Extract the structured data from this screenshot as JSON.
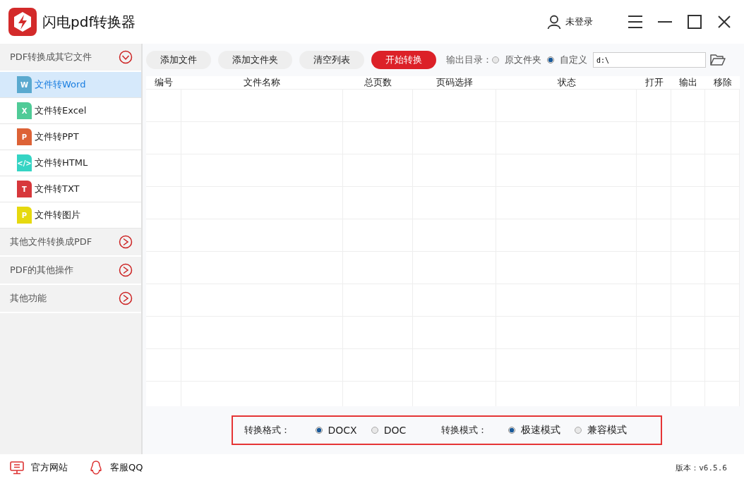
{
  "window": {
    "title": "闪电pdf转换器",
    "user": "未登录"
  },
  "sidebar": {
    "groups": [
      {
        "label": "PDF转换成其它文件",
        "expanded": true,
        "items": [
          {
            "label": "文件转Word",
            "kind": "word",
            "badge": "W",
            "selected": true
          },
          {
            "label": "文件转Excel",
            "kind": "excel",
            "badge": "X",
            "selected": false
          },
          {
            "label": "文件转PPT",
            "kind": "ppt",
            "badge": "P",
            "selected": false
          },
          {
            "label": "文件转HTML",
            "kind": "html",
            "badge": "</>",
            "selected": false
          },
          {
            "label": "文件转TXT",
            "kind": "txt",
            "badge": "T",
            "selected": false
          },
          {
            "label": "文件转图片",
            "kind": "image",
            "badge": "P",
            "selected": false
          }
        ]
      },
      {
        "label": "其他文件转换成PDF",
        "expanded": false
      },
      {
        "label": "PDF的其他操作",
        "expanded": false
      },
      {
        "label": "其他功能",
        "expanded": false
      }
    ]
  },
  "toolbar": {
    "buttons": [
      {
        "label": "添加文件",
        "primary": false
      },
      {
        "label": "添加文件夹",
        "primary": false
      },
      {
        "label": "清空列表",
        "primary": false
      },
      {
        "label": "开始转换",
        "primary": true
      }
    ],
    "output_label": "输出目录：",
    "output_options": [
      {
        "label": "原文件夹",
        "selected": false
      },
      {
        "label": "自定义",
        "selected": true
      }
    ],
    "path": "d:\\"
  },
  "table": {
    "columns": [
      "编号",
      "文件名称",
      "总页数",
      "页码选择",
      "状态",
      "打开",
      "输出",
      "移除"
    ]
  },
  "options": {
    "format_label": "转换格式：",
    "formats": [
      {
        "label": "DOCX",
        "selected": true
      },
      {
        "label": "DOC",
        "selected": false
      }
    ],
    "mode_label": "转换模式：",
    "modes": [
      {
        "label": "极速模式",
        "selected": true
      },
      {
        "label": "兼容模式",
        "selected": false
      }
    ]
  },
  "footer": {
    "links": [
      {
        "label": "官方网站",
        "kind": "website"
      },
      {
        "label": "客服QQ",
        "kind": "qq"
      }
    ],
    "version": "版本：v6.5.6"
  }
}
